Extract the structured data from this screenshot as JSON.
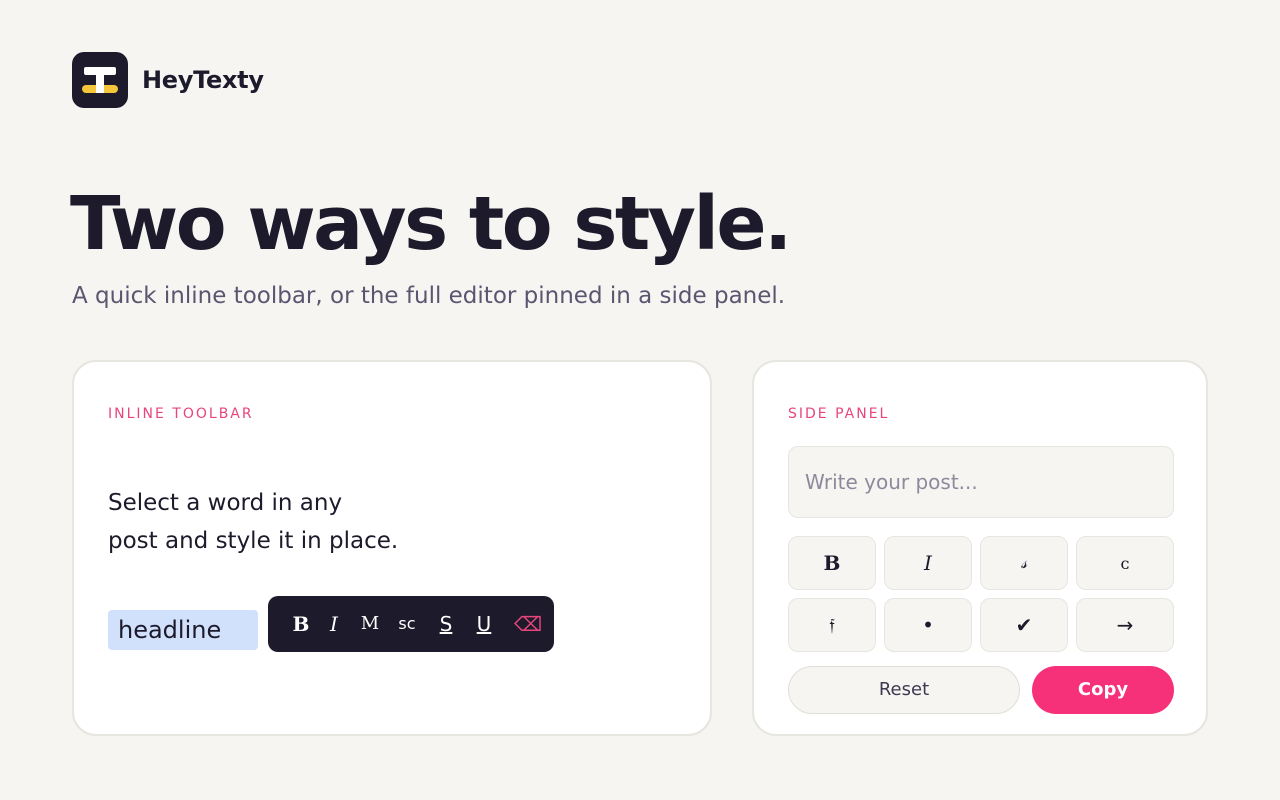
{
  "brand": {
    "name": "HeyTexty",
    "logo_icon": "text-t-icon",
    "colors": {
      "dark": "#1c1a2b",
      "accent_yellow": "#f5c53a"
    }
  },
  "hero": {
    "title": "Two ways to style.",
    "subtitle": "A quick inline toolbar, or the full editor pinned in a side panel."
  },
  "inline_card": {
    "label": "INLINE TOOLBAR",
    "lead_line1": "Select a word in any",
    "lead_line2": "post and style it in place.",
    "selected_word": "headline",
    "toolbar": {
      "bold": "B",
      "italic": "I",
      "mono": "M",
      "small_caps": "sc",
      "strike": "S",
      "underline": "U",
      "clear": "⌫"
    }
  },
  "side_panel": {
    "label": "SIDE PANEL",
    "input_placeholder": "Write your post...",
    "buttons": [
      {
        "glyph": "B",
        "icon": "bold-icon"
      },
      {
        "glyph": "I",
        "icon": "italic-icon"
      },
      {
        "glyph": "𝓈",
        "icon": "script-icon"
      },
      {
        "glyph": "ᴄ",
        "icon": "small-caps-icon"
      },
      {
        "glyph": "𝔣",
        "icon": "fraktur-icon"
      },
      {
        "glyph": "•",
        "icon": "bullet-icon"
      },
      {
        "glyph": "✔",
        "icon": "checkmark-icon"
      },
      {
        "glyph": "→",
        "icon": "arrow-right-icon"
      }
    ],
    "reset_label": "Reset",
    "copy_label": "Copy"
  },
  "colors": {
    "background": "#f6f5f2",
    "accent_pink": "#f6317a",
    "label_pink": "#e8457d",
    "selection_blue": "#d2e1fb"
  }
}
